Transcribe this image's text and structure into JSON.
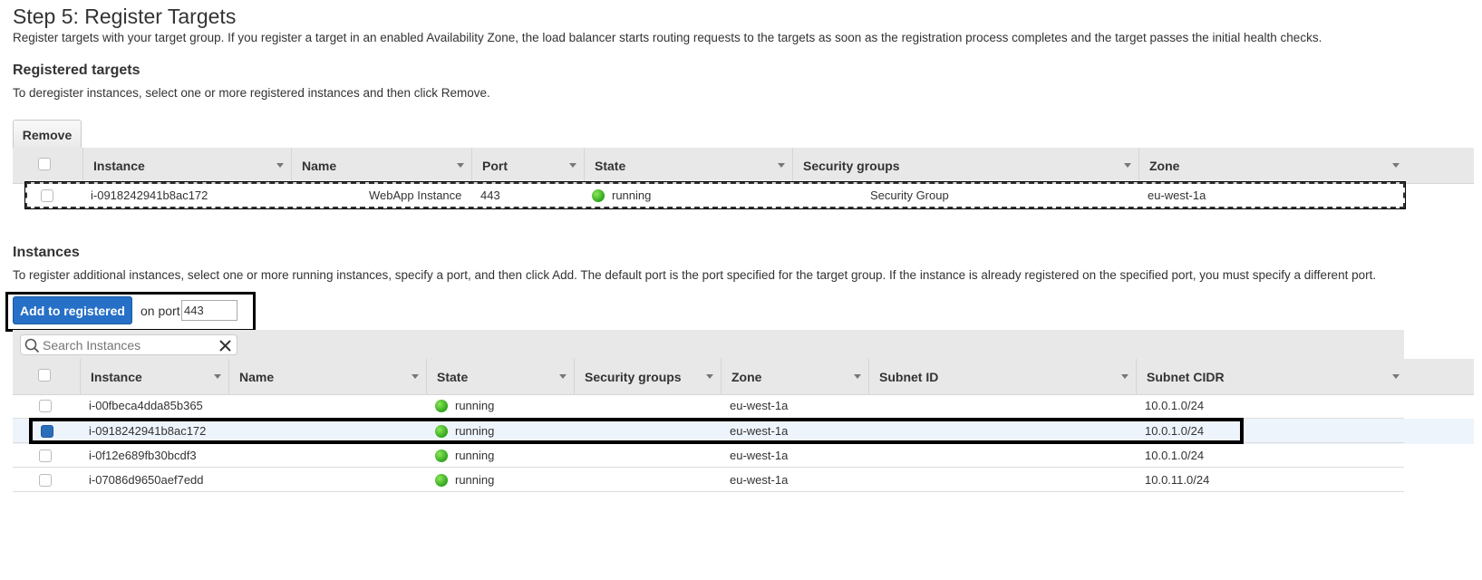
{
  "step": {
    "title": "Step 5: Register Targets",
    "description": "Register targets with your target group. If you register a target in an enabled Availability Zone, the load balancer starts routing requests to the targets as soon as the registration process completes and the target passes the initial health checks."
  },
  "registered": {
    "title": "Registered targets",
    "description": "To deregister instances, select one or more registered instances and then click Remove.",
    "remove_label": "Remove",
    "columns": [
      "Instance",
      "Name",
      "Port",
      "State",
      "Security groups",
      "Zone"
    ],
    "rows": [
      {
        "instance": "i-0918242941b8ac172",
        "name": "WebApp Instance",
        "port": "443",
        "state": "running",
        "security_groups": "Security Group",
        "zone": "eu-west-1a"
      }
    ]
  },
  "instances": {
    "title": "Instances",
    "description": "To register additional instances, select one or more running instances, specify a port, and then click Add. The default port is the port specified for the target group. If the instance is already registered on the specified port, you must specify a different port.",
    "add_label": "Add to registered",
    "on_port_label": "on port",
    "port_value": "443",
    "search_placeholder": "Search Instances",
    "columns": [
      "Instance",
      "Name",
      "State",
      "Security groups",
      "Zone",
      "Subnet ID",
      "Subnet CIDR"
    ],
    "rows": [
      {
        "instance": "i-00fbeca4dda85b365",
        "state": "running",
        "zone": "eu-west-1a",
        "subnet_cidr": "10.0.1.0/24",
        "selected": false
      },
      {
        "instance": "i-0918242941b8ac172",
        "state": "running",
        "zone": "eu-west-1a",
        "subnet_cidr": "10.0.1.0/24",
        "selected": true
      },
      {
        "instance": "i-0f12e689fb30bcdf3",
        "state": "running",
        "zone": "eu-west-1a",
        "subnet_cidr": "10.0.1.0/24",
        "selected": false
      },
      {
        "instance": "i-07086d9650aef7edd",
        "state": "running",
        "zone": "eu-west-1a",
        "subnet_cidr": "10.0.11.0/24",
        "selected": false
      }
    ]
  },
  "colors": {
    "primary": "#2670c7",
    "running": "#2fa51b",
    "header_bg": "#e8e8e8",
    "selected_row": "#eef4fb"
  }
}
